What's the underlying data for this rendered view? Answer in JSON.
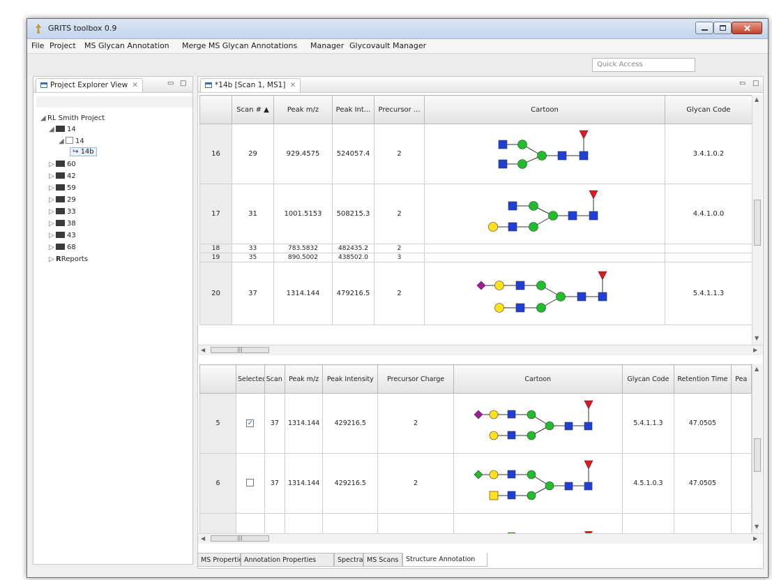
{
  "window": {
    "title": "GRITS toolbox 0.9"
  },
  "menu": [
    "File",
    "Project",
    "MS Glycan Annotation",
    "Merge MS Glycan Annotations",
    "Manager",
    "Glycovault Manager"
  ],
  "quick_access": {
    "placeholder": "Quick Access"
  },
  "explorer": {
    "tab_label": "Project Explorer View",
    "tree": {
      "root": "RL Smith Project",
      "expanded_sample": "14",
      "expanded_child": "14",
      "selected": "14b",
      "samples": [
        "60",
        "42",
        "59",
        "29",
        "33",
        "38",
        "43",
        "68"
      ],
      "reports": "Reports"
    }
  },
  "editor": {
    "tab_label": "*14b [Scan 1, MS1]",
    "top_table": {
      "columns": [
        "",
        "Scan # ▲",
        "Peak m/z",
        "Peak Int...",
        "Precursor ...",
        "Cartoon",
        "Glycan Code"
      ],
      "rows": [
        {
          "row": "16",
          "scan": "29",
          "mz": "929.4575",
          "intensity": "524057.4",
          "charge": "2",
          "code": "3.4.1.0.2"
        },
        {
          "row": "17",
          "scan": "31",
          "mz": "1001.5153",
          "intensity": "508215.3",
          "charge": "2",
          "code": "4.4.1.0.0"
        },
        {
          "row": "18",
          "scan": "33",
          "mz": "783.5832",
          "intensity": "482435.2",
          "charge": "2",
          "code": ""
        },
        {
          "row": "19",
          "scan": "35",
          "mz": "890.5002",
          "intensity": "438502.0",
          "charge": "3",
          "code": ""
        },
        {
          "row": "20",
          "scan": "37",
          "mz": "1314.144",
          "intensity": "479216.5",
          "charge": "2",
          "code": "5.4.1.1.3"
        }
      ]
    },
    "bottom_table": {
      "columns": [
        "",
        "Selected",
        "Scan #",
        "Peak m/z",
        "Peak Intensity",
        "Precursor Charge",
        "Cartoon",
        "Glycan Code",
        "Retention Time",
        "Pea"
      ],
      "rows": [
        {
          "row": "5",
          "selected": true,
          "scan": "37",
          "mz": "1314.144",
          "intensity": "429216.5",
          "charge": "2",
          "code": "5.4.1.1.3",
          "rt": "47.0505"
        },
        {
          "row": "6",
          "selected": false,
          "scan": "37",
          "mz": "1314.144",
          "intensity": "429216.5",
          "charge": "2",
          "code": "4.5.1.0.3",
          "rt": "47.0505"
        }
      ]
    },
    "bottom_tabs": [
      "MS Properties",
      "Annotation Properties",
      "Spectra",
      "MS Scans",
      "Structure Annotation"
    ],
    "active_bottom_tab": "Structure Annotation"
  },
  "colors": {
    "glcnac": "#1f3fd9",
    "mannose": "#1fbe2a",
    "galactose": "#ffe11a",
    "fucose": "#e8141e",
    "neuac": "#a3199a"
  }
}
